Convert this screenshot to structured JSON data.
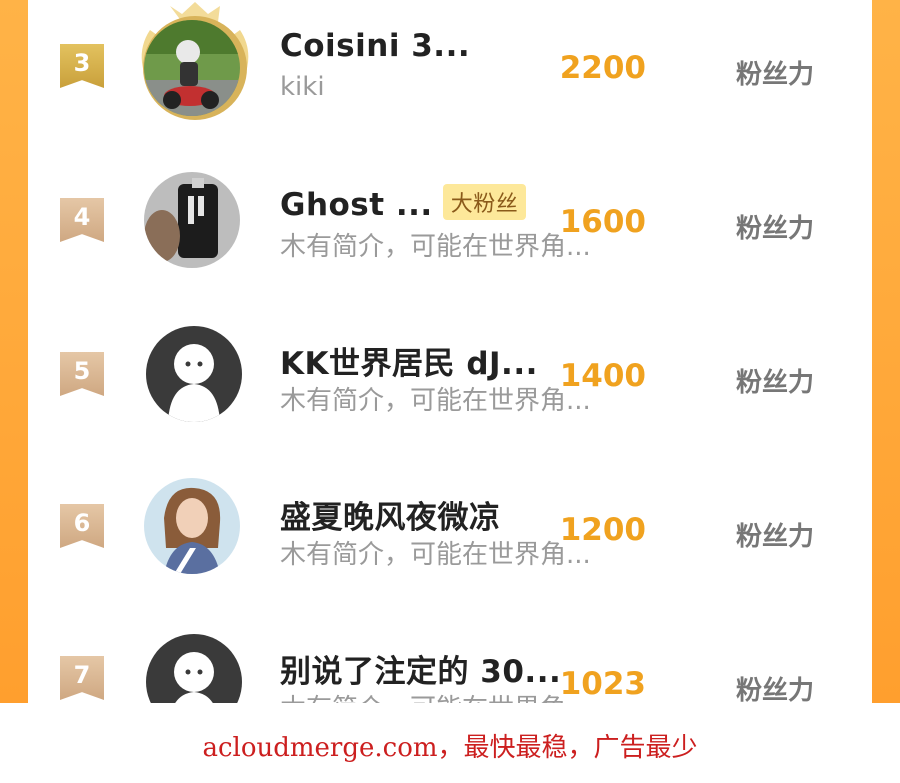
{
  "ranking": {
    "rows": [
      {
        "rank": "3",
        "name": "Coisini  3...",
        "subtitle": "kiki",
        "score": "2200",
        "unit": "粉丝力",
        "badge": ""
      },
      {
        "rank": "4",
        "name": "Ghost  ...",
        "subtitle": "木有简介，可能在世界角...",
        "score": "1600",
        "unit": "粉丝力",
        "badge": "大粉丝"
      },
      {
        "rank": "5",
        "name": "KK世界居民  dJ...",
        "subtitle": "木有简介，可能在世界角...",
        "score": "1400",
        "unit": "粉丝力",
        "badge": ""
      },
      {
        "rank": "6",
        "name": "盛夏晚风夜微凉",
        "subtitle": "木有简介，可能在世界角...",
        "score": "1200",
        "unit": "粉丝力",
        "badge": ""
      },
      {
        "rank": "7",
        "name": "别说了注定的  30...",
        "subtitle": "木有简介，可能在世界角...",
        "score": "1023",
        "unit": "粉丝力",
        "badge": ""
      }
    ]
  },
  "footer": {
    "text": "acloudmerge.com，最快最稳，广告最少"
  },
  "colors": {
    "accent": "#f0a21f",
    "side": "#ff9f2e",
    "badge_bg": "#fde89a",
    "footer_text": "#cc1f1f"
  }
}
